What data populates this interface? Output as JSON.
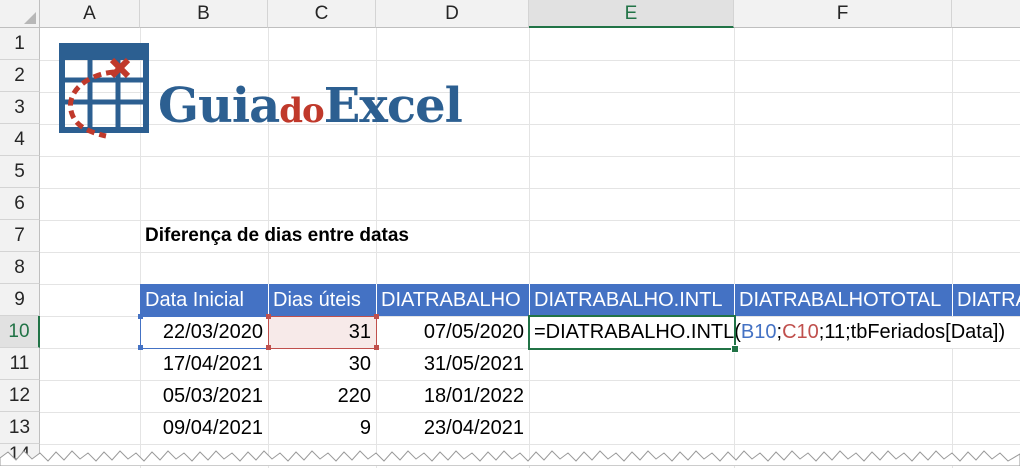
{
  "columns": [
    "A",
    "B",
    "C",
    "D",
    "E",
    "F"
  ],
  "rows": [
    "1",
    "2",
    "3",
    "4",
    "5",
    "6",
    "7",
    "8",
    "9",
    "10",
    "11",
    "12",
    "13",
    "14"
  ],
  "logo": {
    "part1": "Guia",
    "part2": "do",
    "part3": "Excel"
  },
  "title": "Diferença de dias entre datas",
  "table": {
    "headers": [
      "Data Inicial",
      "Dias úteis",
      "DIATRABALHO",
      "DIATRABALHO.INTL",
      "DIATRABALHOTOTAL",
      "DIATRA"
    ],
    "rows": [
      [
        "22/03/2020",
        "31",
        "07/05/2020"
      ],
      [
        "17/04/2021",
        "30",
        "31/05/2021"
      ],
      [
        "05/03/2021",
        "220",
        "18/01/2022"
      ],
      [
        "09/04/2021",
        "9",
        "23/04/2021"
      ]
    ]
  },
  "formula": {
    "prefix": "=DIATRABALHO.INTL(",
    "ref1": "B10",
    "sep1": ";",
    "ref2": "C10",
    "suffix": ";11;tbFeriados[Data])"
  },
  "active_cell": "E10",
  "colors": {
    "table_header": "#4472c4",
    "ref_b": "#4472c4",
    "ref_c": "#c0504d",
    "selection": "#217346",
    "logo_blue": "#2c5f91",
    "logo_red": "#c0392b"
  }
}
